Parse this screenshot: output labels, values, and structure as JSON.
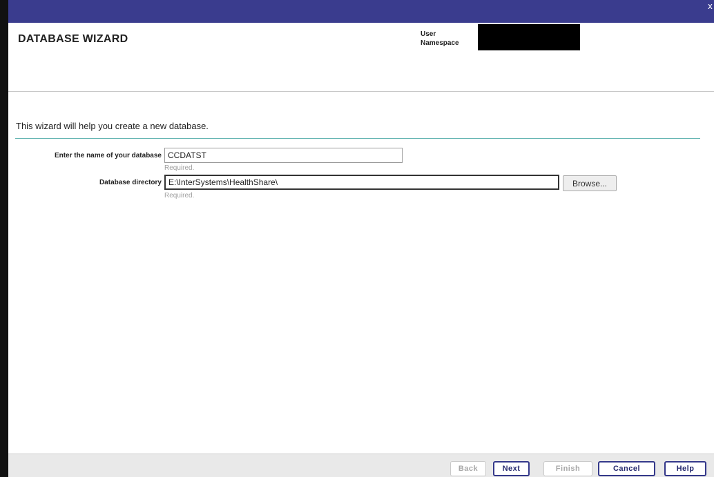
{
  "window": {
    "close_glyph": "x",
    "title_bar_color": "#3a3c8e"
  },
  "header": {
    "title": "DATABASE WIZARD",
    "user_label": "User",
    "namespace_label": "Namespace"
  },
  "intro_text": "This wizard will help you create a new database.",
  "form": {
    "db_name": {
      "label": "Enter the name of your database",
      "value": "CCDATST",
      "hint": "Required."
    },
    "db_directory": {
      "label": "Database directory",
      "value": "E:\\InterSystems\\HealthShare\\",
      "hint": "Required.",
      "browse_label": "Browse..."
    }
  },
  "footer": {
    "back_label": "Back",
    "next_label": "Next",
    "finish_label": "Finish",
    "cancel_label": "Cancel",
    "help_label": "Help"
  },
  "colors": {
    "accent": "#34388a",
    "divider": "#5fb3b0"
  }
}
